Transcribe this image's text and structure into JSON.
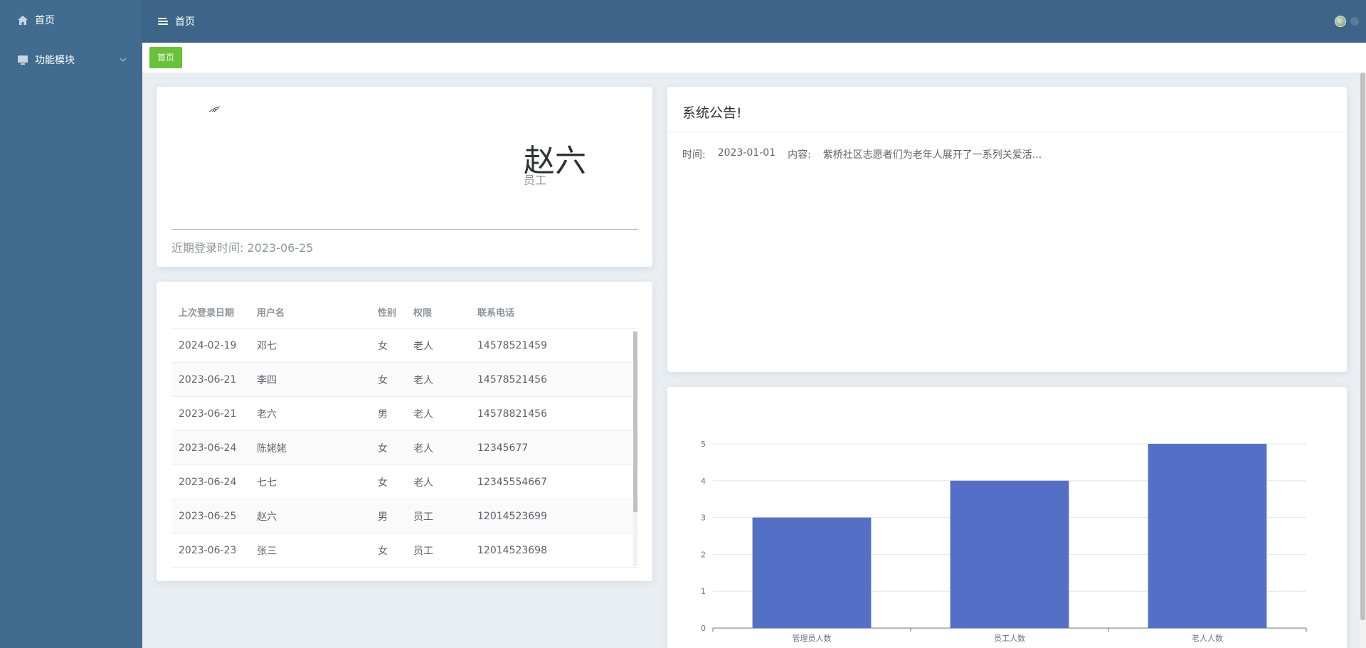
{
  "sidebar": {
    "items": [
      {
        "label": "首页",
        "icon": "home-icon"
      },
      {
        "label": "功能模块",
        "icon": "monitor-icon"
      }
    ]
  },
  "header": {
    "title": "首页"
  },
  "tabs": {
    "active": "首页"
  },
  "profile": {
    "name": "赵六",
    "role": "员工",
    "last_login": "近期登录时间: 2023-06-25"
  },
  "users_table": {
    "headers": [
      "上次登录日期",
      "用户名",
      "性别",
      "权限",
      "联系电话"
    ],
    "rows": [
      [
        "2024-02-19",
        "邓七",
        "女",
        "老人",
        "14578521459"
      ],
      [
        "2023-06-21",
        "李四",
        "女",
        "老人",
        "14578521456"
      ],
      [
        "2023-06-21",
        "老六",
        "男",
        "老人",
        "14578821456"
      ],
      [
        "2023-06-24",
        "陈姥姥",
        "女",
        "老人",
        "12345677"
      ],
      [
        "2023-06-24",
        "七七",
        "女",
        "老人",
        "12345554667"
      ],
      [
        "2023-06-25",
        "赵六",
        "男",
        "员工",
        "12014523699"
      ],
      [
        "2023-06-23",
        "张三",
        "女",
        "员工",
        "12014523698"
      ]
    ]
  },
  "notice": {
    "title": "系统公告!",
    "time_label": "时间:",
    "time": "2023-01-01",
    "content_label": "内容:",
    "content": "紫桥社区志愿者们为老年人展开了一系列关爱活..."
  },
  "chart_data": {
    "type": "bar",
    "categories": [
      "管理员人数",
      "员工人数",
      "老人人数"
    ],
    "values": [
      3,
      4,
      5
    ],
    "ylim": [
      0,
      5
    ],
    "yticks": [
      0,
      1,
      2,
      3,
      4,
      5
    ],
    "color": "#5470c6",
    "grid": true
  },
  "colors": {
    "sidebar": "#416b8f",
    "header": "#3c6589",
    "tab_active": "#67c23a",
    "bar": "#5470c6"
  }
}
